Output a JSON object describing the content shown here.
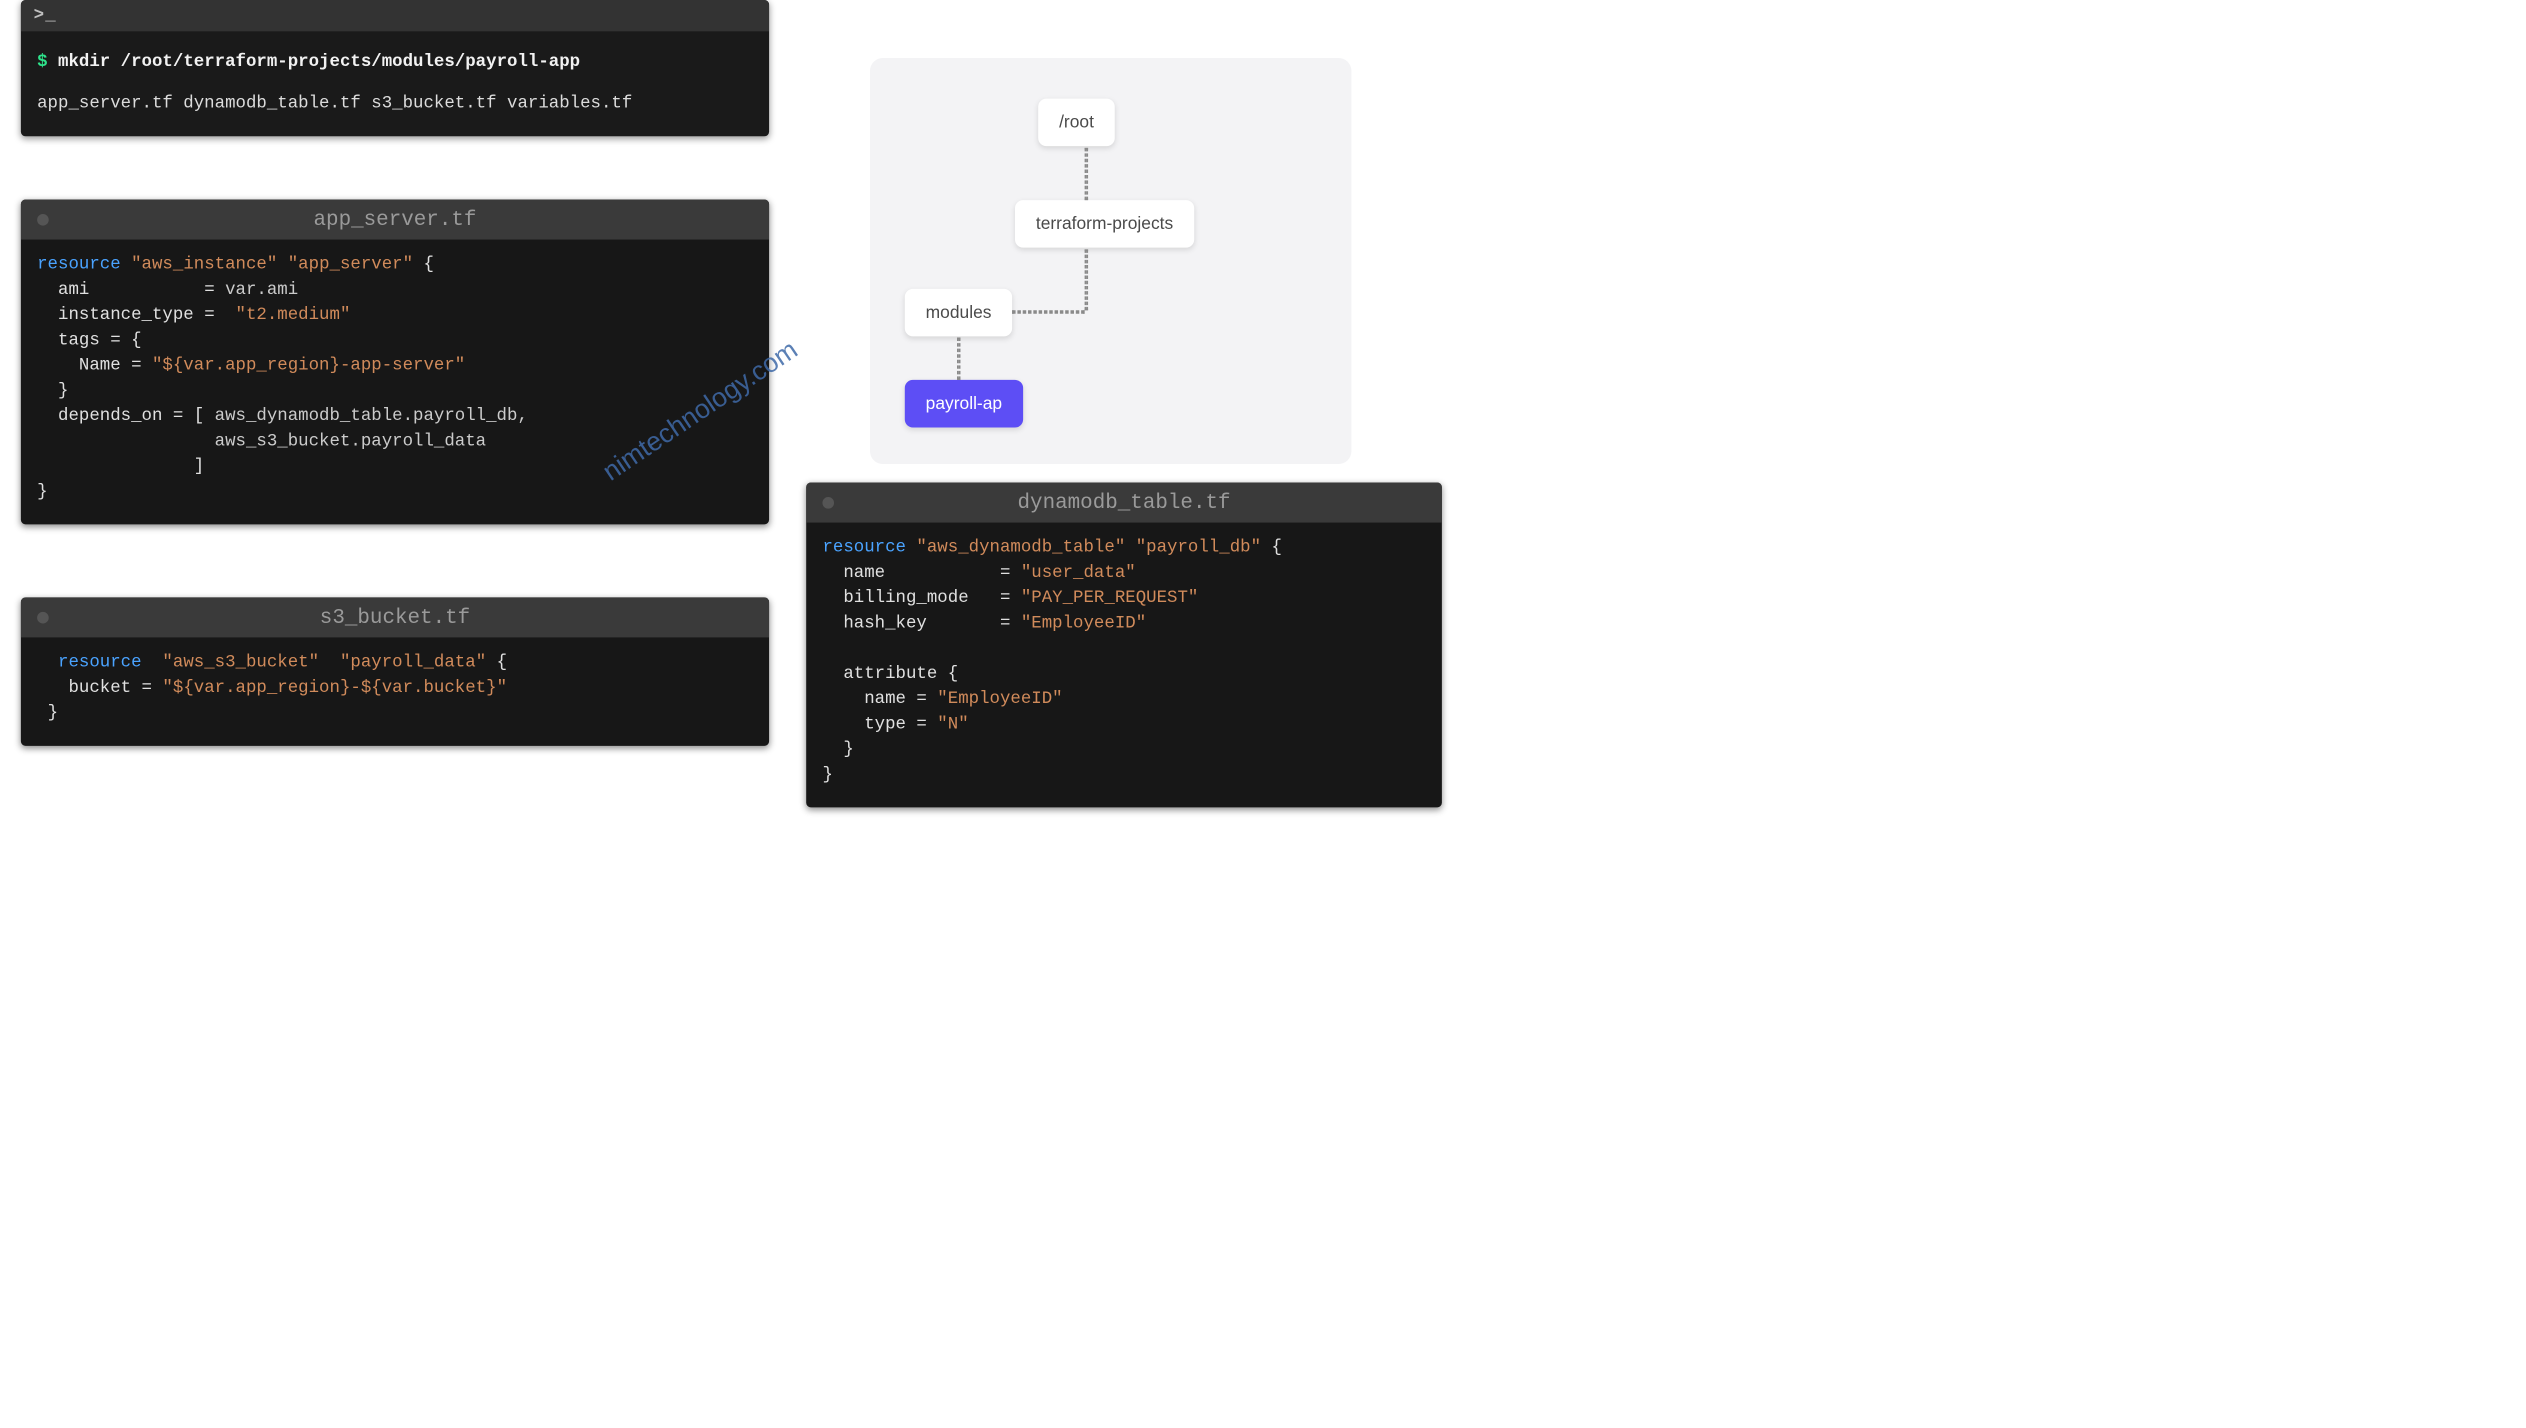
{
  "terminal": {
    "prompt_icon": ">_",
    "dollar": "$",
    "command": "mkdir /root/terraform-projects/modules/payroll-app",
    "file_list": "app_server.tf dynamodb_table.tf s3_bucket.tf variables.tf"
  },
  "panel_appserver": {
    "title": "app_server.tf",
    "code": {
      "kw": "resource",
      "type": "\"aws_instance\"",
      "name": "\"app_server\"",
      "ami_key": "ami",
      "ami_val": "var.ami",
      "itype_key": "instance_type",
      "itype_val": "\"t2.medium\"",
      "tags_key": "tags = {",
      "tag_name_key": "Name",
      "tag_name_val1": "\"${var.app_region}",
      "tag_name_val2": "-app-server\"",
      "depends_key": "depends_on",
      "depends_val1": "aws_dynamodb_table.payroll_db,",
      "depends_val2": "aws_s3_bucket.payroll_data"
    }
  },
  "panel_s3": {
    "title": "s3_bucket.tf",
    "code": {
      "kw": "resource",
      "type": "\"aws_s3_bucket\"",
      "name": "\"payroll_data\"",
      "bucket_key": "bucket",
      "bucket_val": "\"${var.app_region}-${var.bucket}\""
    }
  },
  "panel_dynamo": {
    "title": "dynamodb_table.tf",
    "code": {
      "kw": "resource",
      "type": "\"aws_dynamodb_table\"",
      "name": "\"payroll_db\"",
      "name_key": "name",
      "name_val": "\"user_data\"",
      "billing_key": "billing_mode",
      "billing_val": "\"PAY_PER_REQUEST\"",
      "hash_key": "hash_key",
      "hash_val": "\"EmployeeID\"",
      "attr_key": "attribute {",
      "attr_name_key": "name",
      "attr_name_val": "\"EmployeeID\"",
      "attr_type_key": "type",
      "attr_type_val": "\"N\""
    }
  },
  "tree": {
    "n0": "/root",
    "n1": "terraform-projects",
    "n2": "modules",
    "n3": "payroll-ap"
  },
  "watermark": "nimtechnology.com"
}
